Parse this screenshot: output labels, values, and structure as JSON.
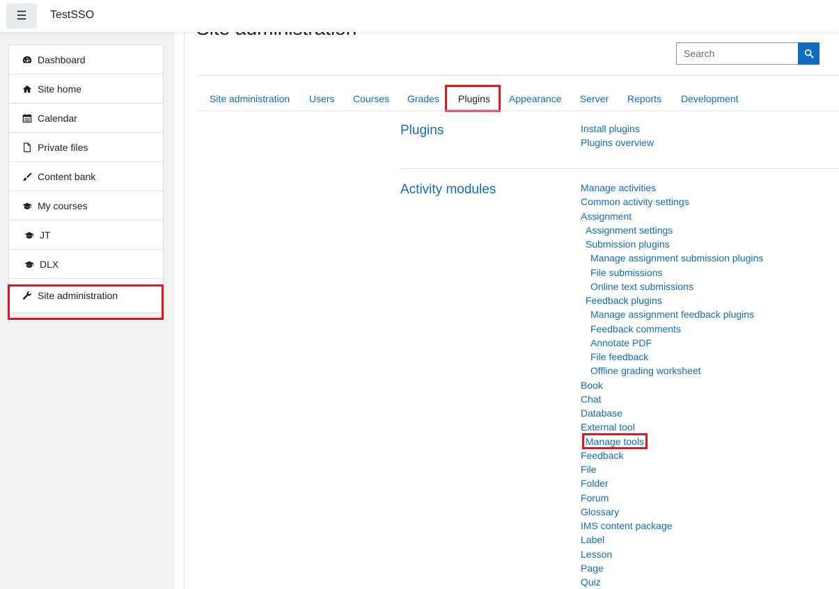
{
  "navbar": {
    "site_name": "TestSSO",
    "menu_icon": "hamburger-icon"
  },
  "drawer": {
    "items": [
      {
        "label": "Dashboard",
        "icon": "dashboard-icon"
      },
      {
        "label": "Site home",
        "icon": "home-icon"
      },
      {
        "label": "Calendar",
        "icon": "calendar-icon"
      },
      {
        "label": "Private files",
        "icon": "file-icon"
      },
      {
        "label": "Content bank",
        "icon": "paintbrush-icon"
      },
      {
        "label": "My courses",
        "icon": "graduation-cap-icon"
      },
      {
        "label": "JT",
        "icon": "graduation-cap-icon"
      },
      {
        "label": "DLX",
        "icon": "graduation-cap-icon"
      },
      {
        "label": "Site administration",
        "icon": "wrench-icon"
      }
    ],
    "highlight_color": "#e0161e"
  },
  "main": {
    "page_heading": "Site administration",
    "search": {
      "placeholder": "Search",
      "value": ""
    },
    "tabs": [
      {
        "label": "Site administration"
      },
      {
        "label": "Users"
      },
      {
        "label": "Courses"
      },
      {
        "label": "Grades"
      },
      {
        "label": "Plugins",
        "active": true
      },
      {
        "label": "Appearance"
      },
      {
        "label": "Server"
      },
      {
        "label": "Reports"
      },
      {
        "label": "Development"
      }
    ],
    "sections": {
      "plugins": {
        "title": "Plugins",
        "links": [
          "Install plugins",
          "Plugins overview"
        ]
      },
      "activity_modules": {
        "title": "Activity modules",
        "links": [
          {
            "label": "Manage activities",
            "level": 0
          },
          {
            "label": "Common activity settings",
            "level": 0
          },
          {
            "label": "Assignment",
            "level": 0
          },
          {
            "label": "Assignment settings",
            "level": 1
          },
          {
            "label": "Submission plugins",
            "level": 1
          },
          {
            "label": "Manage assignment submission plugins",
            "level": 2
          },
          {
            "label": "File submissions",
            "level": 2
          },
          {
            "label": "Online text submissions",
            "level": 2
          },
          {
            "label": "Feedback plugins",
            "level": 1
          },
          {
            "label": "Manage assignment feedback plugins",
            "level": 2
          },
          {
            "label": "Feedback comments",
            "level": 2
          },
          {
            "label": "Annotate PDF",
            "level": 2
          },
          {
            "label": "File feedback",
            "level": 2
          },
          {
            "label": "Offline grading worksheet",
            "level": 2
          },
          {
            "label": "Book",
            "level": 0
          },
          {
            "label": "Chat",
            "level": 0
          },
          {
            "label": "Database",
            "level": 0
          },
          {
            "label": "External tool",
            "level": 0
          },
          {
            "label": "Manage tools",
            "level": 1
          },
          {
            "label": "Feedback",
            "level": 0
          },
          {
            "label": "File",
            "level": 0
          },
          {
            "label": "Folder",
            "level": 0
          },
          {
            "label": "Forum",
            "level": 0
          },
          {
            "label": "Glossary",
            "level": 0
          },
          {
            "label": "IMS content package",
            "level": 0
          },
          {
            "label": "Label",
            "level": 0
          },
          {
            "label": "Lesson",
            "level": 0
          },
          {
            "label": "Page",
            "level": 0
          },
          {
            "label": "Quiz",
            "level": 0
          }
        ]
      }
    }
  },
  "colors": {
    "link": "#0f6cbf",
    "highlight": "#e0161e",
    "drawer_bg": "#f2f2f2"
  }
}
